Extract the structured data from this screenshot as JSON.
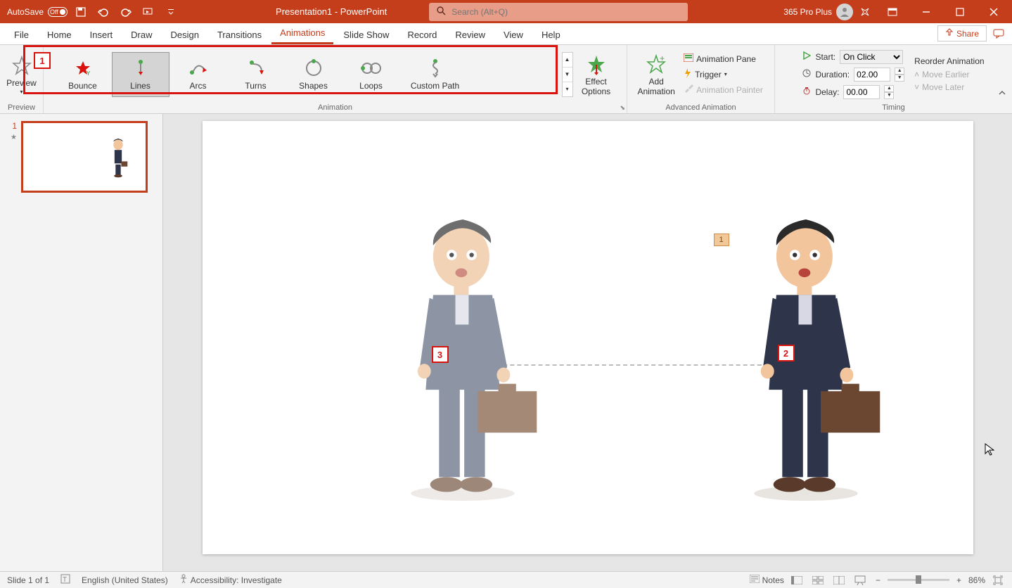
{
  "title_bar": {
    "autosave_label": "AutoSave",
    "autosave_state": "Off",
    "doc_title": "Presentation1 - PowerPoint",
    "search_placeholder": "Search (Alt+Q)",
    "account": "365 Pro Plus"
  },
  "tabs": {
    "file": "File",
    "home": "Home",
    "insert": "Insert",
    "draw": "Draw",
    "design": "Design",
    "transitions": "Transitions",
    "animations": "Animations",
    "slideshow": "Slide Show",
    "record": "Record",
    "review": "Review",
    "view": "View",
    "help": "Help",
    "share": "Share"
  },
  "ribbon": {
    "preview_group": {
      "preview": "Preview",
      "group_label": "Preview"
    },
    "animation_group": {
      "group_label": "Animation",
      "bounce": "Bounce",
      "lines": "Lines",
      "arcs": "Arcs",
      "turns": "Turns",
      "shapes": "Shapes",
      "loops": "Loops",
      "custom_path": "Custom Path",
      "effect_options": "Effect\nOptions"
    },
    "advanced_group": {
      "group_label": "Advanced Animation",
      "add_animation": "Add\nAnimation",
      "animation_pane": "Animation Pane",
      "trigger": "Trigger",
      "animation_painter": "Animation Painter"
    },
    "timing_group": {
      "group_label": "Timing",
      "start_label": "Start:",
      "start_value": "On Click",
      "duration_label": "Duration:",
      "duration_value": "02.00",
      "delay_label": "Delay:",
      "delay_value": "00.00",
      "reorder_title": "Reorder Animation",
      "move_earlier": "Move Earlier",
      "move_later": "Move Later"
    }
  },
  "markers": {
    "m1": "1",
    "m2": "2",
    "m3": "3"
  },
  "slide_tag": "1",
  "thumb_num": "1",
  "status": {
    "slide": "Slide 1 of 1",
    "lang": "English (United States)",
    "accessibility": "Accessibility: Investigate",
    "notes": "Notes",
    "zoom": "86%"
  }
}
